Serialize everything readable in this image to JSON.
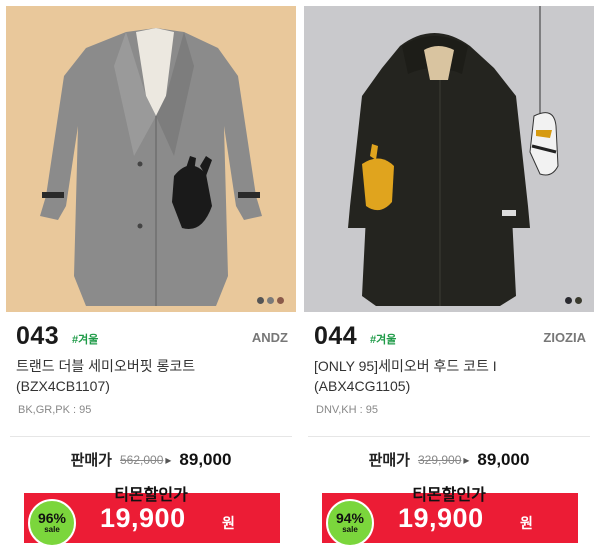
{
  "products": [
    {
      "number": "043",
      "tag": "#겨울",
      "brand": "ANDZ",
      "title_line1": "트랜드 더블 세미오버핏 롱코트",
      "title_line2": "(BZX4CB1107)",
      "options": "BK,GR,PK : 95",
      "price_label": "판매가",
      "original_price": "562,000",
      "price": "89,000",
      "discount_label": "티몬할인가",
      "discount_percent": "96%",
      "sale_text": "sale",
      "sale_price": "19,900",
      "currency": "원",
      "swatch_colors": [
        "#555555",
        "#7a7a7a",
        "#8a5a4a"
      ]
    },
    {
      "number": "044",
      "tag": "#겨울",
      "brand": "ZIOZIA",
      "title_line1": "[ONLY 95]세미오버 후드 코트 I",
      "title_line2": "(ABX4CG1105)",
      "options": "DNV,KH : 95",
      "price_label": "판매가",
      "original_price": "329,900",
      "price": "89,000",
      "discount_label": "티몬할인가",
      "discount_percent": "94%",
      "sale_text": "sale",
      "sale_price": "19,900",
      "currency": "원",
      "swatch_colors": [
        "#2a2a30",
        "#3a3a2e"
      ]
    }
  ],
  "colors": {
    "accent_red": "#ec1c35",
    "badge_green": "#7bd63c",
    "tag_green": "#1f9b48"
  }
}
